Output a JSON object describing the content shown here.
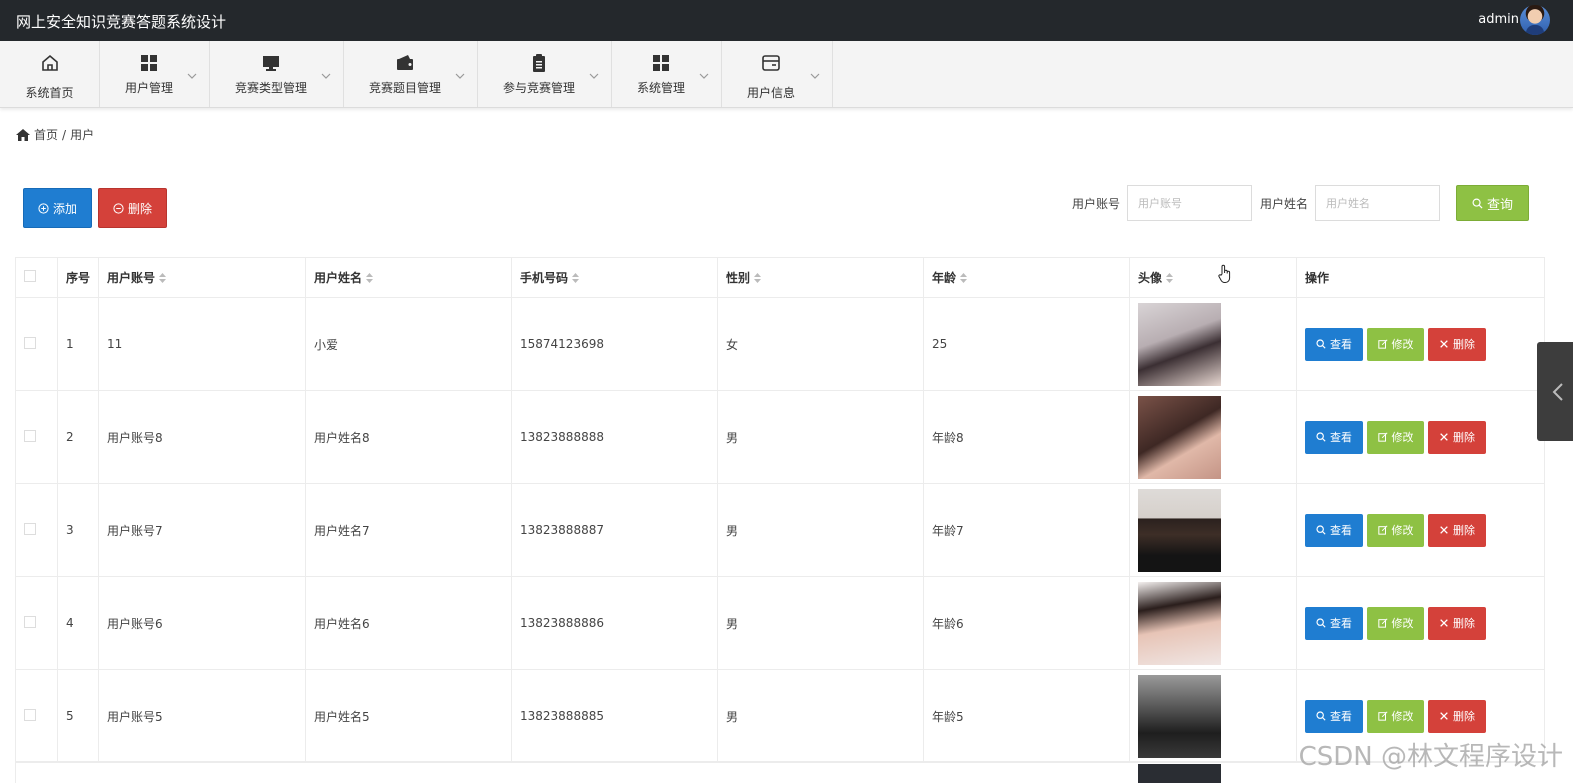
{
  "app": {
    "title": "网上安全知识竞赛答题系统设计",
    "user": "admin"
  },
  "nav": [
    {
      "label": "系统首页",
      "icon": "home-icon"
    },
    {
      "label": "用户管理",
      "icon": "grid-icon"
    },
    {
      "label": "竞赛类型管理",
      "icon": "monitor-icon"
    },
    {
      "label": "竞赛题目管理",
      "icon": "wallet-icon"
    },
    {
      "label": "参与竞赛管理",
      "icon": "clipboard-icon"
    },
    {
      "label": "系统管理",
      "icon": "grid-icon"
    },
    {
      "label": "用户信息",
      "icon": "card-icon"
    }
  ],
  "breadcrumb": {
    "home": "首页",
    "sep": "/",
    "current": "用户"
  },
  "toolbar": {
    "add_label": "添加",
    "delete_label": "删除"
  },
  "search": {
    "account_label": "用户账号",
    "account_placeholder": "用户账号",
    "name_label": "用户姓名",
    "name_placeholder": "用户姓名",
    "query_label": "查询"
  },
  "table": {
    "headers": {
      "index": "序号",
      "account": "用户账号",
      "name": "用户姓名",
      "phone": "手机号码",
      "gender": "性别",
      "age": "年龄",
      "avatar": "头像",
      "actions": "操作"
    },
    "actions": {
      "view": "查看",
      "edit": "修改",
      "delete": "删除"
    },
    "rows": [
      {
        "index": "1",
        "account": "11",
        "name": "小爱",
        "phone": "15874123698",
        "gender": "女",
        "age": "25"
      },
      {
        "index": "2",
        "account": "用户账号8",
        "name": "用户姓名8",
        "phone": "13823888888",
        "gender": "男",
        "age": "年龄8"
      },
      {
        "index": "3",
        "account": "用户账号7",
        "name": "用户姓名7",
        "phone": "13823888887",
        "gender": "男",
        "age": "年龄7"
      },
      {
        "index": "4",
        "account": "用户账号6",
        "name": "用户姓名6",
        "phone": "13823888886",
        "gender": "男",
        "age": "年龄6"
      },
      {
        "index": "5",
        "account": "用户账号5",
        "name": "用户姓名5",
        "phone": "13823888885",
        "gender": "男",
        "age": "年龄5"
      }
    ]
  },
  "watermark": "CSDN @林文程序设计",
  "colors": {
    "primary": "#1f7dd1",
    "success": "#8ec144",
    "danger": "#d4413a",
    "header": "#24282c"
  }
}
